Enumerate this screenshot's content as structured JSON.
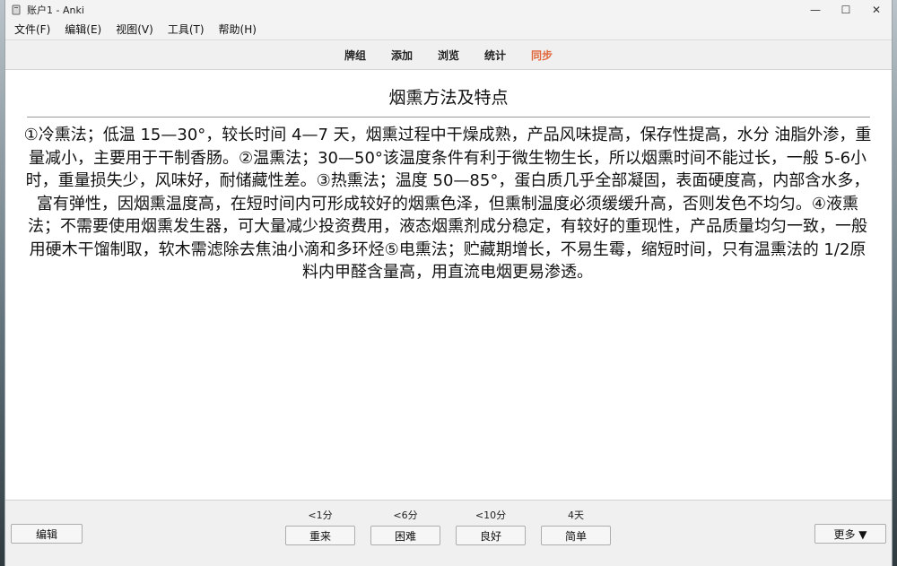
{
  "window": {
    "title": "账户1 - Anki",
    "controls": {
      "minimize": "—",
      "maximize": "☐",
      "close": "✕"
    }
  },
  "menu": [
    "文件(F)",
    "编辑(E)",
    "视图(V)",
    "工具(T)",
    "帮助(H)"
  ],
  "toolbar": {
    "items": [
      "牌组",
      "添加",
      "浏览",
      "统计",
      "同步"
    ],
    "sync_color": "#e0663b"
  },
  "card": {
    "title": "烟熏方法及特点",
    "body": "①冷熏法；低温 15—30°，较长时间 4—7 天，烟熏过程中干燥成熟，产品风味提高，保存性提高，水分 油脂外渗，重量减小，主要用于干制香肠。②温熏法；30—50°该温度条件有利于微生物生长，所以烟熏时间不能过长，一般 5-6小时，重量损失少，风味好，耐储藏性差。③热熏法；温度 50—85°，蛋白质几乎全部凝固，表面硬度高，内部含水多，富有弹性，因烟熏温度高，在短时间内可形成较好的烟熏色泽，但熏制温度必须缓缓升高，否则发色不均匀。④液熏法；不需要使用烟熏发生器，可大量减少投资费用，液态烟熏剂成分稳定，有较好的重现性，产品质量均匀一致，一般用硬木干馏制取，软木需滤除去焦油小滴和多环烃⑤电熏法；贮藏期增长，不易生霉，缩短时间，只有温熏法的 1/2原料内甲醛含量高，用直流电烟更易渗透。"
  },
  "bottom": {
    "edit_label": "编辑",
    "more_label": "更多 ▼",
    "answers": [
      {
        "interval": "<1分",
        "label": "重来"
      },
      {
        "interval": "<6分",
        "label": "困难"
      },
      {
        "interval": "<10分",
        "label": "良好"
      },
      {
        "interval": "4天",
        "label": "简单"
      }
    ]
  }
}
